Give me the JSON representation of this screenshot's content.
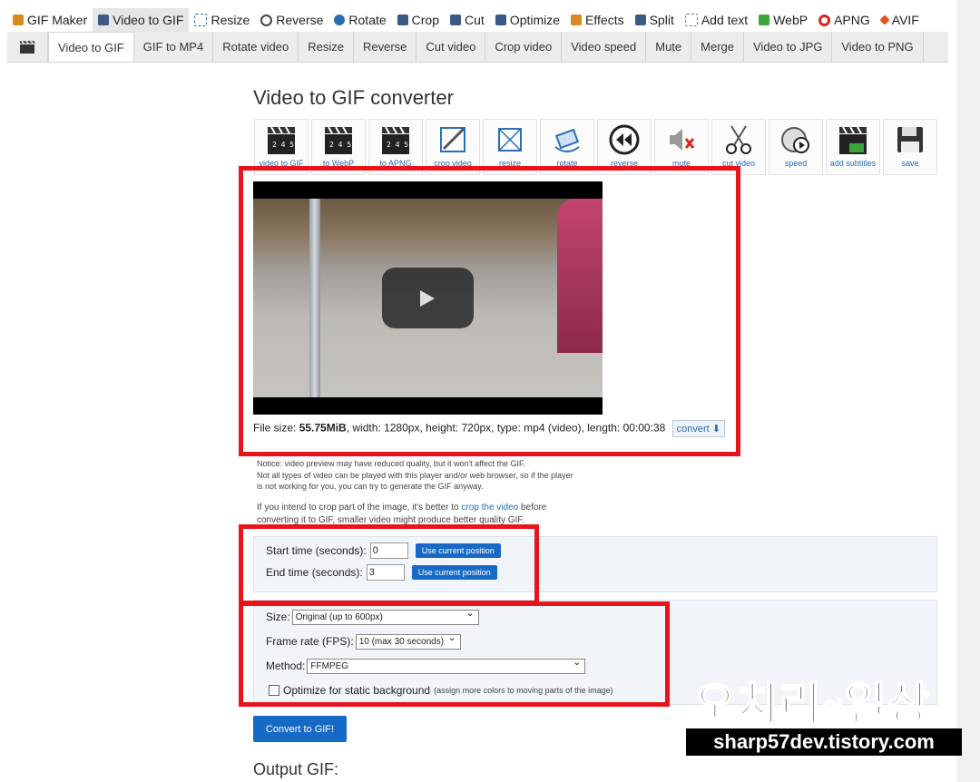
{
  "topnav": [
    {
      "label": "GIF Maker",
      "color": "#d98a1d"
    },
    {
      "label": "Video to GIF",
      "color": "#3c5a86"
    },
    {
      "label": "Resize",
      "color": "#2a6eb5"
    },
    {
      "label": "Reverse",
      "color": "#444444"
    },
    {
      "label": "Rotate",
      "color": "#2a6eb5"
    },
    {
      "label": "Crop",
      "color": "#3c5a86"
    },
    {
      "label": "Cut",
      "color": "#3c5a86"
    },
    {
      "label": "Optimize",
      "color": "#3c5a86"
    },
    {
      "label": "Effects",
      "color": "#d98a1d"
    },
    {
      "label": "Split",
      "color": "#3c5a86"
    },
    {
      "label": "Add text",
      "color": "#777777"
    },
    {
      "label": "WebP",
      "color": "#3aa53a"
    },
    {
      "label": "APNG",
      "color": "#d9241c"
    },
    {
      "label": "AVIF",
      "color": "#e0561c"
    }
  ],
  "subnav": [
    "Video to GIF",
    "GIF to MP4",
    "Rotate video",
    "Resize",
    "Reverse",
    "Cut video",
    "Crop video",
    "Video speed",
    "Mute",
    "Merge",
    "Video to JPG",
    "Video to PNG"
  ],
  "title": "Video to GIF converter",
  "tools": [
    {
      "label": "video to GIF",
      "icon": "clapperboard-icon"
    },
    {
      "label": "to WebP",
      "icon": "clapperboard-icon"
    },
    {
      "label": "to APNG",
      "icon": "clapperboard-icon"
    },
    {
      "label": "crop video",
      "icon": "crop-icon"
    },
    {
      "label": "resize",
      "icon": "resize-icon"
    },
    {
      "label": "rotate",
      "icon": "rotate-icon"
    },
    {
      "label": "reverse",
      "icon": "rewind-icon"
    },
    {
      "label": "mute",
      "icon": "mute-icon"
    },
    {
      "label": "cut video",
      "icon": "scissors-icon"
    },
    {
      "label": "speed",
      "icon": "speed-icon"
    },
    {
      "label": "add subtitles",
      "icon": "subtitles-icon"
    },
    {
      "label": "save",
      "icon": "save-icon"
    }
  ],
  "fileinfo": {
    "prefix": "File size: ",
    "size": "55.75MiB",
    "rest": ", width: 1280px, height: 720px, type: mp4 (video), length: 00:00:38",
    "convert": "convert"
  },
  "notice": {
    "line1": "Notice: video preview may have reduced quality, but it won't affect the GIF.",
    "line2": "Not all types of video can be played with this player and/or web browser, so if the player",
    "line3": "is not working for you, you can try to generate the GIF anyway."
  },
  "crophint": {
    "before": "If you intend to crop part of the image, it's better to ",
    "link": "crop the video",
    "after": " before",
    "line2": "converting it to GIF, smaller video might produce better quality GIF."
  },
  "start": {
    "label": "Start time (seconds):",
    "value": "0",
    "button": "Use current position"
  },
  "end": {
    "label": "End time (seconds):",
    "value": "3",
    "button": "Use current position"
  },
  "size": {
    "label": "Size:",
    "value": "Original (up to 600px)"
  },
  "fps": {
    "label": "Frame rate (FPS):",
    "value": "10 (max 30 seconds)"
  },
  "method": {
    "label": "Method:",
    "value": "FFMPEG"
  },
  "optimize": {
    "label": "Optimize for static background",
    "note": "(assign more colors to moving parts of the image)",
    "checked": false
  },
  "convert_button": "Convert to GIF!",
  "output_title": "Output GIF:",
  "watermark": {
    "title": "오치리",
    "particle": "의",
    "title2": "일상",
    "url": "sharp57dev.tistory.com"
  }
}
